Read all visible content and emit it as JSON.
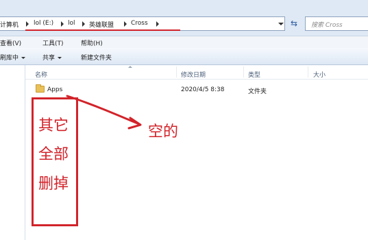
{
  "breadcrumb": {
    "items": [
      "计算机",
      "lol (E:)",
      "lol",
      "英雄联盟",
      "Cross"
    ]
  },
  "search": {
    "placeholder": "搜索 Cross"
  },
  "menu": {
    "items": [
      "查看(V)",
      "工具(T)",
      "帮助(H)"
    ]
  },
  "toolbar": {
    "include_label": "刷库中",
    "share_label": "共享",
    "new_folder_label": "新建文件夹"
  },
  "columns": {
    "name": "名称",
    "date": "修改日期",
    "type": "类型",
    "size": "大小"
  },
  "files": [
    {
      "name": "Apps",
      "modified": "2020/4/5 8:38",
      "type": "文件夹",
      "size": ""
    }
  ],
  "annotations": {
    "box_lines": [
      "其它",
      "全部",
      "删掉"
    ],
    "arrow_label": "空的",
    "color": "#d2232a"
  }
}
